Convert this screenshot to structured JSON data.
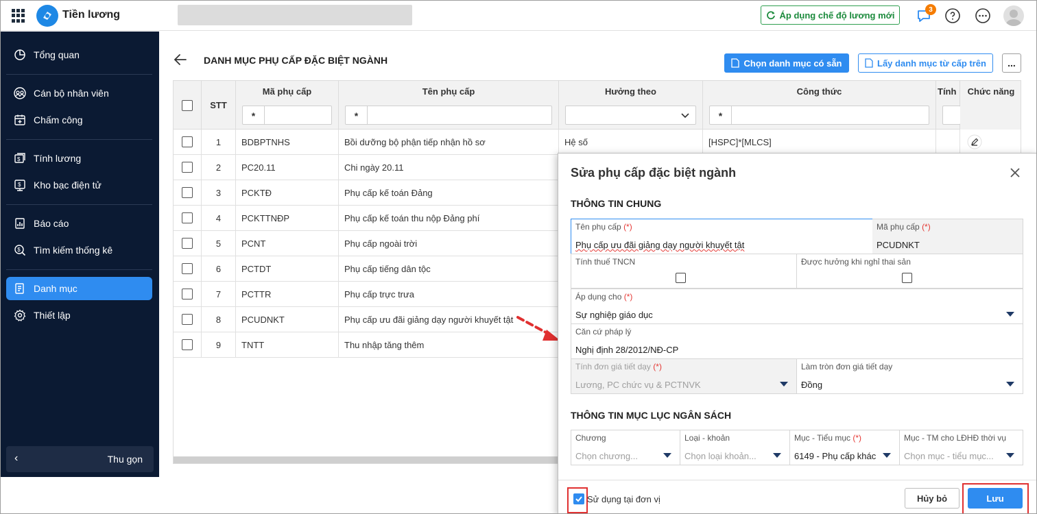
{
  "app": {
    "title": "Tiền lương"
  },
  "topbar": {
    "apply_button": "Áp dụng chế độ lương mới",
    "notification_count": "3"
  },
  "sidebar": {
    "items": [
      {
        "label": "Tổng quan",
        "icon": "pie-chart-icon"
      },
      {
        "label": "Cán bộ nhân viên",
        "icon": "users-icon"
      },
      {
        "label": "Chấm công",
        "icon": "calendar-icon"
      },
      {
        "label": "Tính lương",
        "icon": "salary-icon"
      },
      {
        "label": "Kho bạc điện tử",
        "icon": "treasury-icon"
      },
      {
        "label": "Báo cáo",
        "icon": "report-icon"
      },
      {
        "label": "Tìm kiếm thống kê",
        "icon": "search-dollar-icon"
      },
      {
        "label": "Danh mục",
        "icon": "catalog-icon",
        "active": true
      },
      {
        "label": "Thiết lập",
        "icon": "gear-icon"
      }
    ],
    "collapse_label": "Thu gọn"
  },
  "page": {
    "title": "DANH MỤC PHỤ CẤP ĐẶC BIỆT NGÀNH",
    "btn_choose": "Chọn danh mục có sẵn",
    "btn_fetch": "Lấy danh mục từ cấp trên",
    "btn_more": "..."
  },
  "table": {
    "headers": {
      "stt": "STT",
      "code": "Mã phụ cấp",
      "name": "Tên phụ cấp",
      "basis": "Hưởng theo",
      "formula": "Công thức",
      "tax": "Tính",
      "actions": "Chức năng"
    },
    "filter_star": "*",
    "rows": [
      {
        "stt": "1",
        "code": "BDBPTNHS",
        "name": "Bồi dưỡng bộ phận tiếp nhận hồ sơ",
        "basis": "Hệ số",
        "formula": "[HSPC]*[MLCS]"
      },
      {
        "stt": "2",
        "code": "PC20.11",
        "name": "Chi ngày 20.11",
        "basis": "",
        "formula": ""
      },
      {
        "stt": "3",
        "code": "PCKTĐ",
        "name": "Phụ cấp kế toán Đảng",
        "basis": "",
        "formula": ""
      },
      {
        "stt": "4",
        "code": "PCKTTNĐP",
        "name": "Phụ cấp kế toán thu nộp Đảng phí",
        "basis": "",
        "formula": ""
      },
      {
        "stt": "5",
        "code": "PCNT",
        "name": "Phụ cấp ngoài trời",
        "basis": "",
        "formula": ""
      },
      {
        "stt": "6",
        "code": "PCTDT",
        "name": "Phụ cấp tiếng dân tộc",
        "basis": "",
        "formula": ""
      },
      {
        "stt": "7",
        "code": "PCTTR",
        "name": "Phụ cấp trực trưa",
        "basis": "",
        "formula": ""
      },
      {
        "stt": "8",
        "code": "PCUDNKT",
        "name": "Phụ cấp ưu đãi giảng dạy người khuyết tật",
        "basis": "",
        "formula": ""
      },
      {
        "stt": "9",
        "code": "TNTT",
        "name": "Thu nhập tăng thêm",
        "basis": "",
        "formula": ""
      }
    ]
  },
  "dialog": {
    "title": "Sửa phụ cấp đặc biệt ngành",
    "section_general": "THÔNG TIN CHUNG",
    "section_budget": "THÔNG TIN MỤC LỤC NGÂN SÁCH",
    "required_mark": "(*)",
    "fields": {
      "name_label": "Tên phụ cấp",
      "name_value": "Phụ cấp ưu đãi giảng dạy người khuyết tật",
      "code_label": "Mã phụ cấp",
      "code_value": "PCUDNKT",
      "tax_label": "Tính thuế TNCN",
      "maternity_label": "Được hưởng khi nghỉ thai sản",
      "apply_label": "Áp dụng cho",
      "apply_value": "Sự nghiệp giáo dục",
      "legal_label": "Căn cứ pháp lý",
      "legal_value": "Nghị định 28/2012/NĐ-CP",
      "unit_price_label": "Tính đơn giá tiết dạy",
      "unit_price_value": "Lương, PC chức vụ & PCTNVK",
      "rounding_label": "Làm tròn đơn giá tiết dạy",
      "rounding_value": "Đồng",
      "chapter_label": "Chương",
      "chapter_placeholder": "Chọn chương...",
      "type_label": "Loại - khoản",
      "type_placeholder": "Chọn loại khoản...",
      "item_label": "Mục - Tiểu mục",
      "item_value": "6149 - Phụ cấp khác",
      "item_ldhd_label": "Mục - TM cho LĐHĐ thời vụ",
      "item_ldhd_placeholder": "Chọn mục - tiểu mục..."
    },
    "use_at_unit": "Sử dụng tại đơn vị",
    "cancel": "Hủy bỏ",
    "save": "Lưu"
  },
  "colors": {
    "accent": "#2f8cf0",
    "sidebar_bg": "#0b1a33",
    "green": "#2e9e4f",
    "annotation_red": "#e03030"
  }
}
